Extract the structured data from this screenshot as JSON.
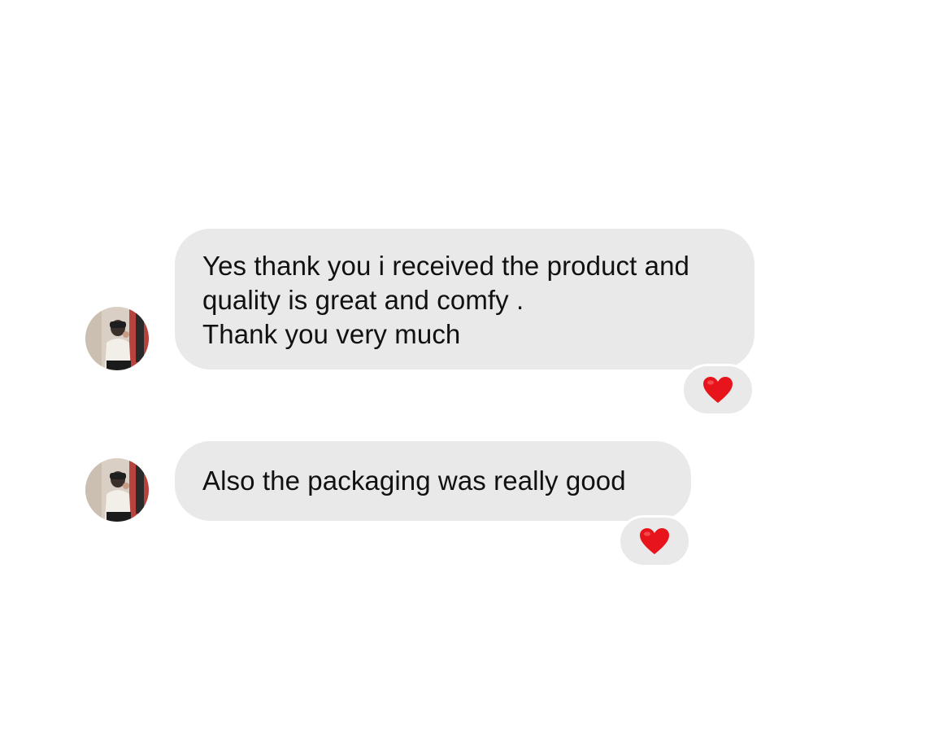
{
  "messages": [
    {
      "lines": [
        "Yes thank you i received the product and",
        "quality is great and comfy .",
        "Thank you very much"
      ],
      "reaction": "red-heart-icon"
    },
    {
      "lines": [
        "Also the packaging was really good"
      ],
      "reaction": "red-heart-icon"
    }
  ],
  "colors": {
    "background": "#ffffff",
    "bubble": "#e9e9e9",
    "text": "#111111",
    "heart": "#e8141c"
  }
}
